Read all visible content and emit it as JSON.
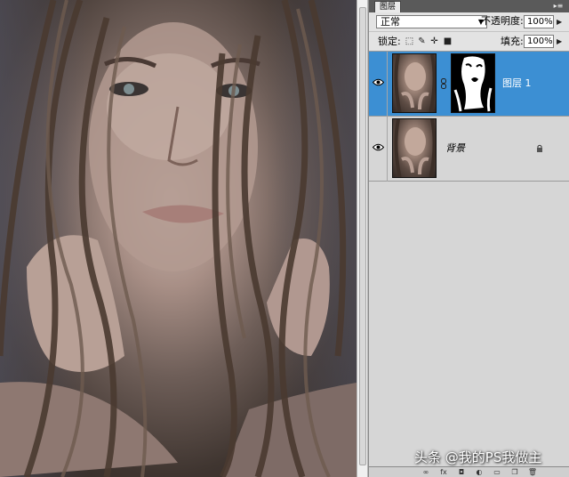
{
  "panel": {
    "tab_label": "图层",
    "blend_mode": "正常",
    "opacity_label": "不透明度:",
    "opacity_value": "100%",
    "lock_label": "锁定:",
    "fill_label": "填充:",
    "fill_value": "100%"
  },
  "layers": [
    {
      "name": "图层 1",
      "selected": true,
      "has_mask": true
    },
    {
      "name": "背景",
      "selected": false,
      "locked": true
    }
  ],
  "watermark": "头条 @我的PS我做主",
  "colors": {
    "selection": "#3c8fd3",
    "panel_bg": "#d6d6d6"
  },
  "icons": [
    "eye-icon",
    "chain-icon",
    "lock-icon",
    "link-layers-icon",
    "fx-icon",
    "mask-icon",
    "adjustment-icon",
    "group-icon",
    "new-layer-icon",
    "trash-icon"
  ]
}
